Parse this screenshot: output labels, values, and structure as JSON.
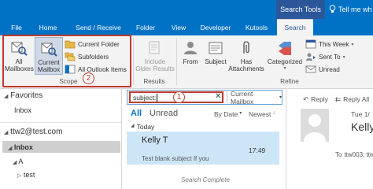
{
  "titlebar": {
    "context_tab": "Search Tools",
    "tellme": "Tell me wh"
  },
  "tabs": [
    "File",
    "Home",
    "Send / Receive",
    "Folder",
    "View",
    "Developer",
    "Kutools",
    "Search"
  ],
  "ribbon": {
    "scope": {
      "all_mailboxes": [
        "All",
        "Mailboxes"
      ],
      "current_mailbox": [
        "Current",
        "Mailbox"
      ],
      "current_folder": "Current Folder",
      "subfolders": "Subfolders",
      "all_outlook_items": "All Outlook Items",
      "label": "Scope",
      "badge": "2"
    },
    "results": {
      "include_older": [
        "Include",
        "Older Results"
      ],
      "label": "Results"
    },
    "refine": {
      "from": "From",
      "subject": "Subject",
      "has_attachments": [
        "Has",
        "Attachments"
      ],
      "categorized": [
        "Categorized"
      ],
      "this_week": "This Week",
      "sent_to": "Sent To",
      "unread": "Unread",
      "label": "Refine"
    }
  },
  "nav": {
    "favorites": "Favorites",
    "inbox1": "Inbox",
    "account": "ttw2@test.com",
    "inbox2": "Inbox",
    "a": "A",
    "test": "test"
  },
  "search": {
    "value": "subject:",
    "badge": "1",
    "scope_dropdown": "Current Mailbox"
  },
  "list": {
    "filter_all": "All",
    "filter_unread": "Unread",
    "sort": "By Date",
    "order": "Newest",
    "group_today": "Today",
    "sender": "Kelly T",
    "time": "17:49",
    "subject": "Test blank subject  If you",
    "status": "Search Complete"
  },
  "reading": {
    "reply": "Reply",
    "reply_all": "Reply All",
    "date": "Tue 1/",
    "sender": "Kelly",
    "to_label": "To",
    "to": "ttw003; ttw"
  },
  "colors": {
    "accent": "#0072c6",
    "tab_dark": "#2b579a",
    "highlight_red": "#c0392b"
  }
}
